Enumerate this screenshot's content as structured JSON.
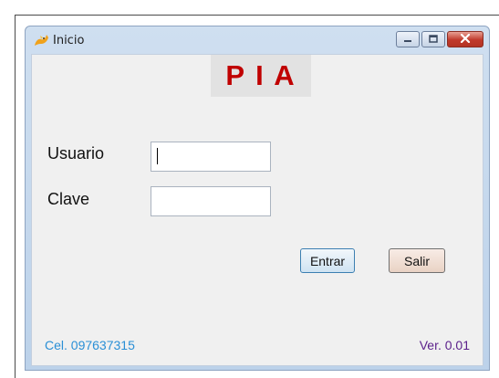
{
  "window": {
    "title": "Inicio"
  },
  "banner": {
    "text": "P I A",
    "color": "#c00000"
  },
  "form": {
    "usuario_label": "Usuario",
    "usuario_value": "",
    "clave_label": "Clave",
    "clave_value": ""
  },
  "buttons": {
    "entrar_label": "Entrar",
    "salir_label": "Salir"
  },
  "footer": {
    "phone": "Cel. 097637315",
    "phone_color": "#2a8fd6",
    "version": "Ver. 0.01",
    "version_color": "#5a1f8a"
  },
  "icons": {
    "app": "cat-icon",
    "minimize": "minimize-icon",
    "maximize": "maximize-icon",
    "close": "close-icon"
  }
}
